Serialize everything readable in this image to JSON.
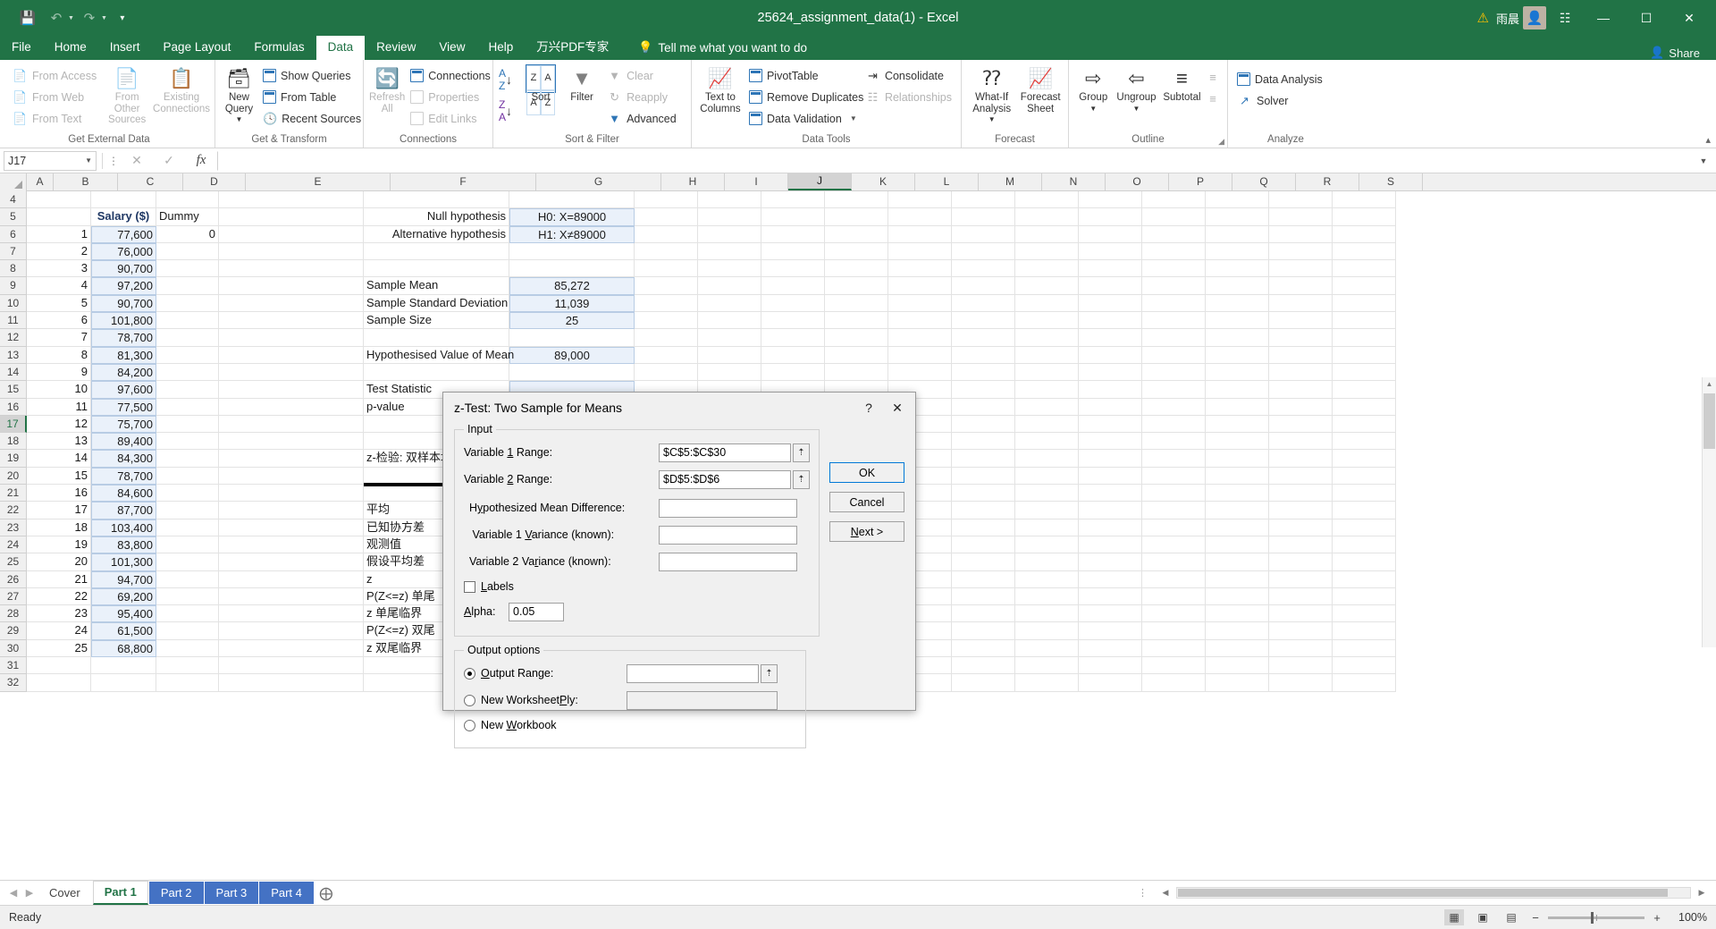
{
  "titlebar": {
    "save_icon": "save-icon",
    "undo_icon": "undo-arrow",
    "redo_icon": "redo-arrow",
    "customize_icon": "customize-qat",
    "title": "25624_assignment_data(1)  -  Excel",
    "warning_icon": "warning-triangle",
    "user_name": "雨晨",
    "avatar_glyph": "user-avatar",
    "ribbon_display_icon": "ribbon-display-options",
    "minimize": "minimize",
    "restore": "restore",
    "close": "close"
  },
  "tabs": {
    "items": [
      "File",
      "Home",
      "Insert",
      "Page Layout",
      "Formulas",
      "Data",
      "Review",
      "View",
      "Help",
      "万兴PDF专家"
    ],
    "active": "Data",
    "tellme": "Tell me what you want to do",
    "share": "Share"
  },
  "ribbon": {
    "groups": [
      {
        "title": "Get External Data",
        "small_items": [
          "From Access",
          "From Web",
          "From Text"
        ],
        "big_items": [
          "From Other Sources",
          "Existing Connections"
        ]
      },
      {
        "title": "Get & Transform",
        "big_items": [
          "New Query"
        ],
        "small_items": [
          "Show Queries",
          "From Table",
          "Recent Sources"
        ]
      },
      {
        "title": "Connections",
        "big_items": [
          "Refresh All"
        ],
        "small_items": [
          "Connections",
          "Properties",
          "Edit Links"
        ]
      },
      {
        "title": "Sort & Filter",
        "big_items": [
          "Sort",
          "Filter"
        ],
        "small_items": [
          "Clear",
          "Reapply",
          "Advanced"
        ]
      },
      {
        "title": "Data Tools",
        "big_items": [
          "Text to Columns"
        ],
        "small_items": [
          "PivotTable",
          "Remove Duplicates",
          "Data Validation",
          "Consolidate",
          "Relationships"
        ]
      },
      {
        "title": "Forecast",
        "big_items": [
          "What-If Analysis",
          "Forecast Sheet"
        ]
      },
      {
        "title": "Outline",
        "big_items": [
          "Group",
          "Ungroup",
          "Subtotal"
        ]
      },
      {
        "title": "Analyze",
        "small_items": [
          "Data Analysis",
          "Solver"
        ]
      }
    ]
  },
  "formulabar": {
    "namebox": "J17",
    "cancel_icon": "cancel-x",
    "enter_icon": "confirm-check",
    "function_icon": "insert-function-fx",
    "value": "",
    "expand_icon": "expand-formula-bar"
  },
  "grid": {
    "columns": [
      "A",
      "B",
      "C",
      "D",
      "E",
      "F",
      "G",
      "H",
      "I",
      "J",
      "K",
      "L",
      "M",
      "N",
      "O",
      "P",
      "Q",
      "R",
      "S"
    ],
    "selected_column": "J",
    "selected_row": "17",
    "rows": [
      "4",
      "5",
      "6",
      "7",
      "8",
      "9",
      "10",
      "11",
      "12",
      "13",
      "14",
      "15",
      "16",
      "17",
      "18",
      "19",
      "20",
      "21",
      "22",
      "23",
      "24",
      "25",
      "26",
      "27",
      "28",
      "29",
      "30",
      "31",
      "32"
    ],
    "headers": {
      "salary": "Salary ($)",
      "dummy": "Dummy",
      "dummy_value": "0"
    },
    "data_index": [
      "1",
      "2",
      "3",
      "4",
      "5",
      "6",
      "7",
      "8",
      "9",
      "10",
      "11",
      "12",
      "13",
      "14",
      "15",
      "16",
      "17",
      "18",
      "19",
      "20",
      "21",
      "22",
      "23",
      "24",
      "25"
    ],
    "salaries": [
      "77,600",
      "76,000",
      "90,700",
      "97,200",
      "90,700",
      "101,800",
      "78,700",
      "81,300",
      "84,200",
      "97,600",
      "77,500",
      "75,700",
      "89,400",
      "84,300",
      "78,700",
      "84,600",
      "87,700",
      "103,400",
      "83,800",
      "101,300",
      "94,700",
      "69,200",
      "95,400",
      "61,500",
      "68,800"
    ],
    "hypothesis": {
      "null_label": "Null hypothesis",
      "null_value": "H0:  X=89000",
      "alt_label": "Alternative hypothesis",
      "alt_value": "H1: X≠89000"
    },
    "stats": [
      {
        "label": "Sample Mean",
        "value": "85,272"
      },
      {
        "label": "Sample Standard Deviation",
        "value": "11,039"
      },
      {
        "label": "Sample Size",
        "value": "25"
      }
    ],
    "hypo_mean": {
      "label": "Hypothesised Value of Mean",
      "value": "89,000"
    },
    "test_labels": [
      "Test Statistic",
      "p-value"
    ],
    "ztest_title": "z-检验: 双样本均值分析",
    "ztest_rows": [
      "平均",
      "已知协方差",
      "观测值",
      "假设平均差",
      "z",
      "P(Z<=z) 单尾",
      "z 单尾临界",
      "P(Z<=z) 双尾",
      "z 双尾临界"
    ]
  },
  "dialog": {
    "title": "z-Test: Two Sample for Means",
    "help_icon": "help-question",
    "close_icon": "close-x",
    "input_group": "Input",
    "fields": [
      {
        "label_a": "Variable ",
        "label_u": "1",
        "label_b": " Range:",
        "value": "$C$5:$C$30"
      },
      {
        "label_a": "Variable ",
        "label_u": "2",
        "label_b": " Range:",
        "value": "$D$5:$D$6"
      }
    ],
    "hyp_mean_diff": {
      "label_a": "H",
      "label_u": "y",
      "label_b": "pothesized Mean Difference:",
      "value": ""
    },
    "var1": {
      "label_a": " Variable 1 ",
      "label_u": "V",
      "label_b": "ariance (known):",
      "value": ""
    },
    "var2": {
      "label_a": "Variable 2 Va",
      "label_u": "r",
      "label_b": "iance (known):",
      "value": ""
    },
    "labels_cb": {
      "label_u": "L",
      "label_b": "abels",
      "checked": false
    },
    "alpha": {
      "label_u": "A",
      "label_b": "lpha:",
      "value": "0.05"
    },
    "output_group": "Output options",
    "output_range": {
      "label_u": "O",
      "label_b": "utput Range:",
      "value": "",
      "selected": true
    },
    "new_worksheet": {
      "label_a": "New Worksheet ",
      "label_u": "P",
      "label_b": "ly:",
      "value": "",
      "selected": false
    },
    "new_workbook": {
      "label_a": "New ",
      "label_u": "W",
      "label_b": "orkbook",
      "selected": false
    },
    "buttons": {
      "ok": "OK",
      "cancel": "Cancel",
      "next": "Next >",
      "next_u": "N"
    },
    "ref_icon": "collapse-dialog-icon"
  },
  "sheets": {
    "items": [
      "Cover",
      "Part 1",
      "Part 2",
      "Part 3",
      "Part 4"
    ],
    "active": "Part 1",
    "colored": [
      "Part 2",
      "Part 3",
      "Part 4"
    ],
    "add_icon": "add-sheet-plus",
    "prev_icon": "prev-sheet",
    "next_icon": "next-sheet"
  },
  "statusbar": {
    "status": "Ready",
    "views": [
      "normal-view-icon",
      "page-layout-icon",
      "page-break-icon"
    ],
    "active_view": "normal-view-icon",
    "zoom_minus": "−",
    "zoom_plus": "+",
    "zoom_level": "100%"
  }
}
